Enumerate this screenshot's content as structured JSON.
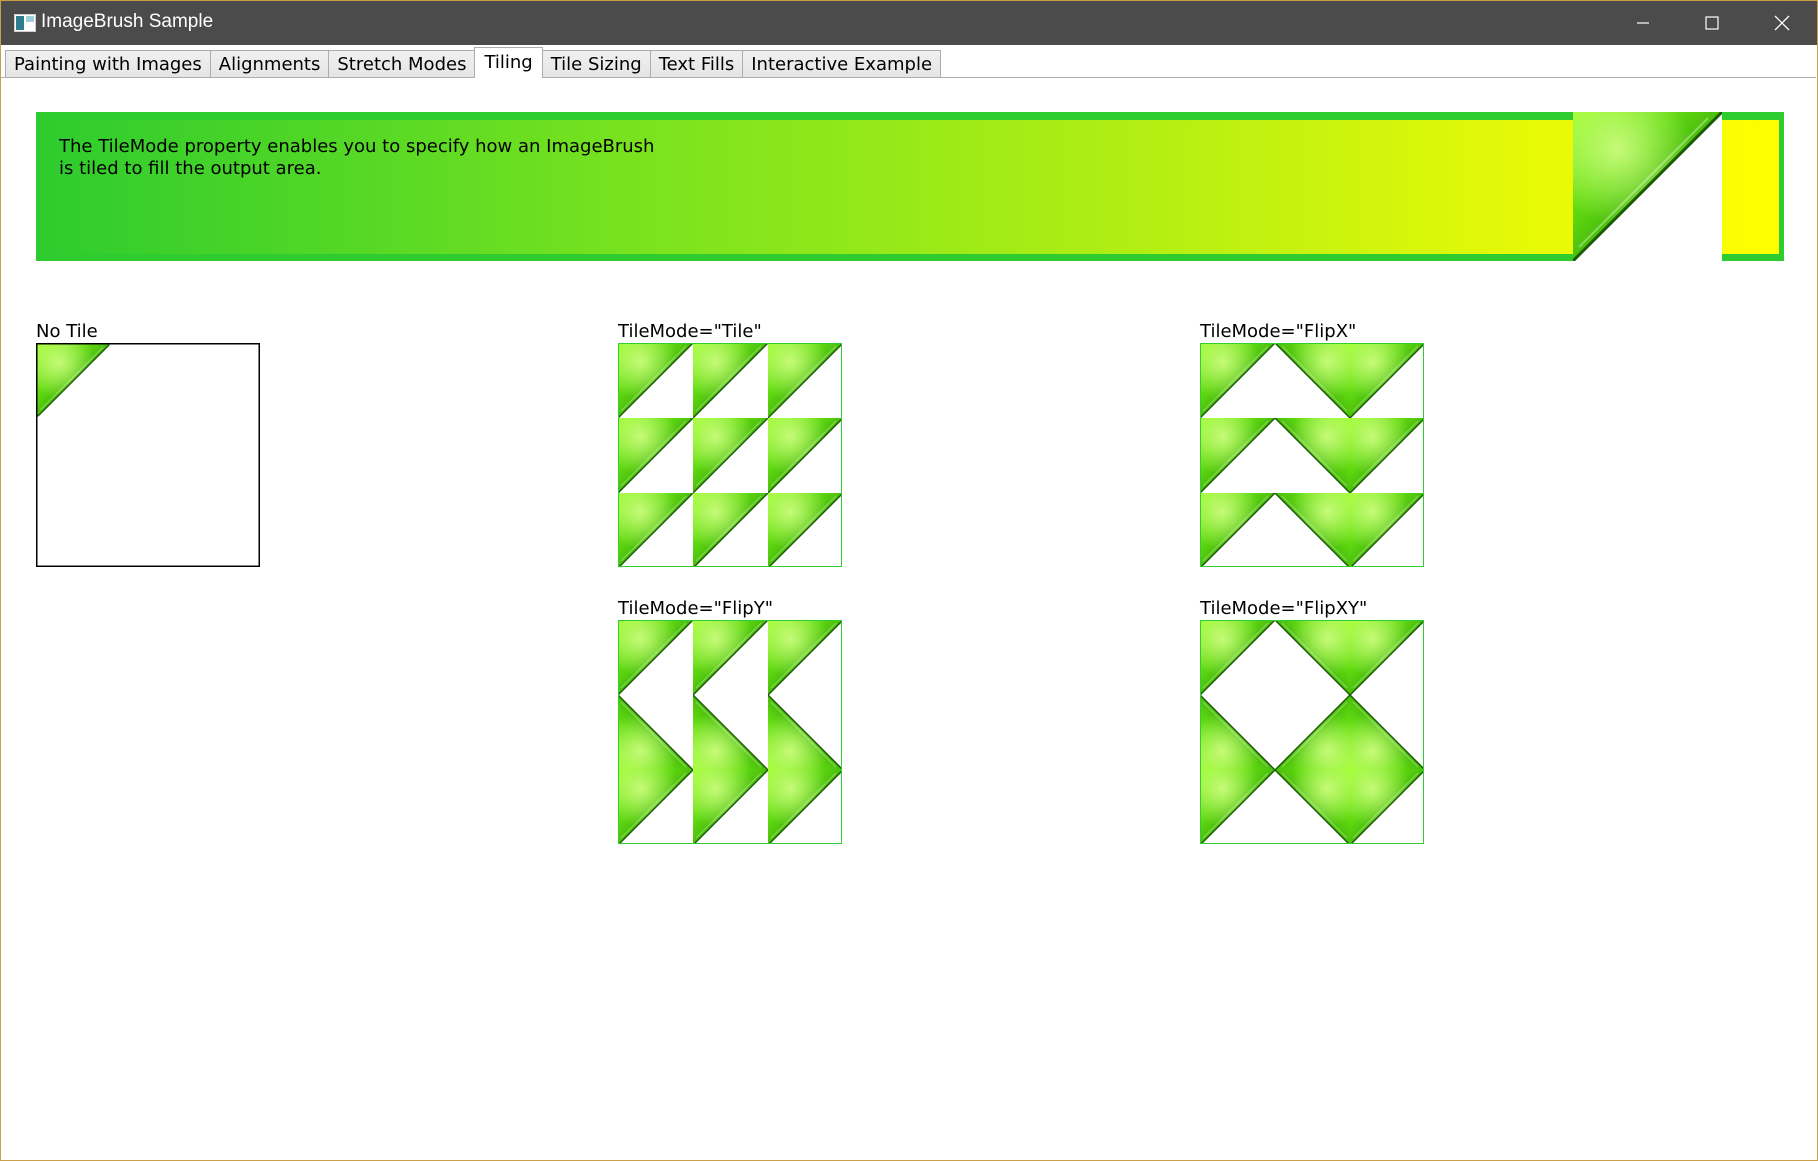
{
  "window": {
    "title": "ImageBrush Sample",
    "controls": [
      "minimize",
      "maximize",
      "close"
    ]
  },
  "tabs": [
    {
      "label": "Painting with Images",
      "selected": false
    },
    {
      "label": "Alignments",
      "selected": false
    },
    {
      "label": "Stretch Modes",
      "selected": false
    },
    {
      "label": "Tiling",
      "selected": true
    },
    {
      "label": "Tile Sizing",
      "selected": false
    },
    {
      "label": "Text Fills",
      "selected": false
    },
    {
      "label": "Interactive Example",
      "selected": false
    }
  ],
  "banner": {
    "line1": "The TileMode property enables you to specify how an ImageBrush",
    "line2": "is tiled to fill the output area."
  },
  "examples": {
    "no_tile": "No Tile",
    "tile": "TileMode=\"Tile\"",
    "flip_x": "TileMode=\"FlipX\"",
    "flip_y": "TileMode=\"FlipY\"",
    "flip_xy": "TileMode=\"FlipXY\""
  },
  "colors": {
    "titlebar": "#4b4b4b",
    "brush_green": "#2ecc2e",
    "brush_yellow": "#ffff00",
    "tile_border": "#32cd32"
  }
}
